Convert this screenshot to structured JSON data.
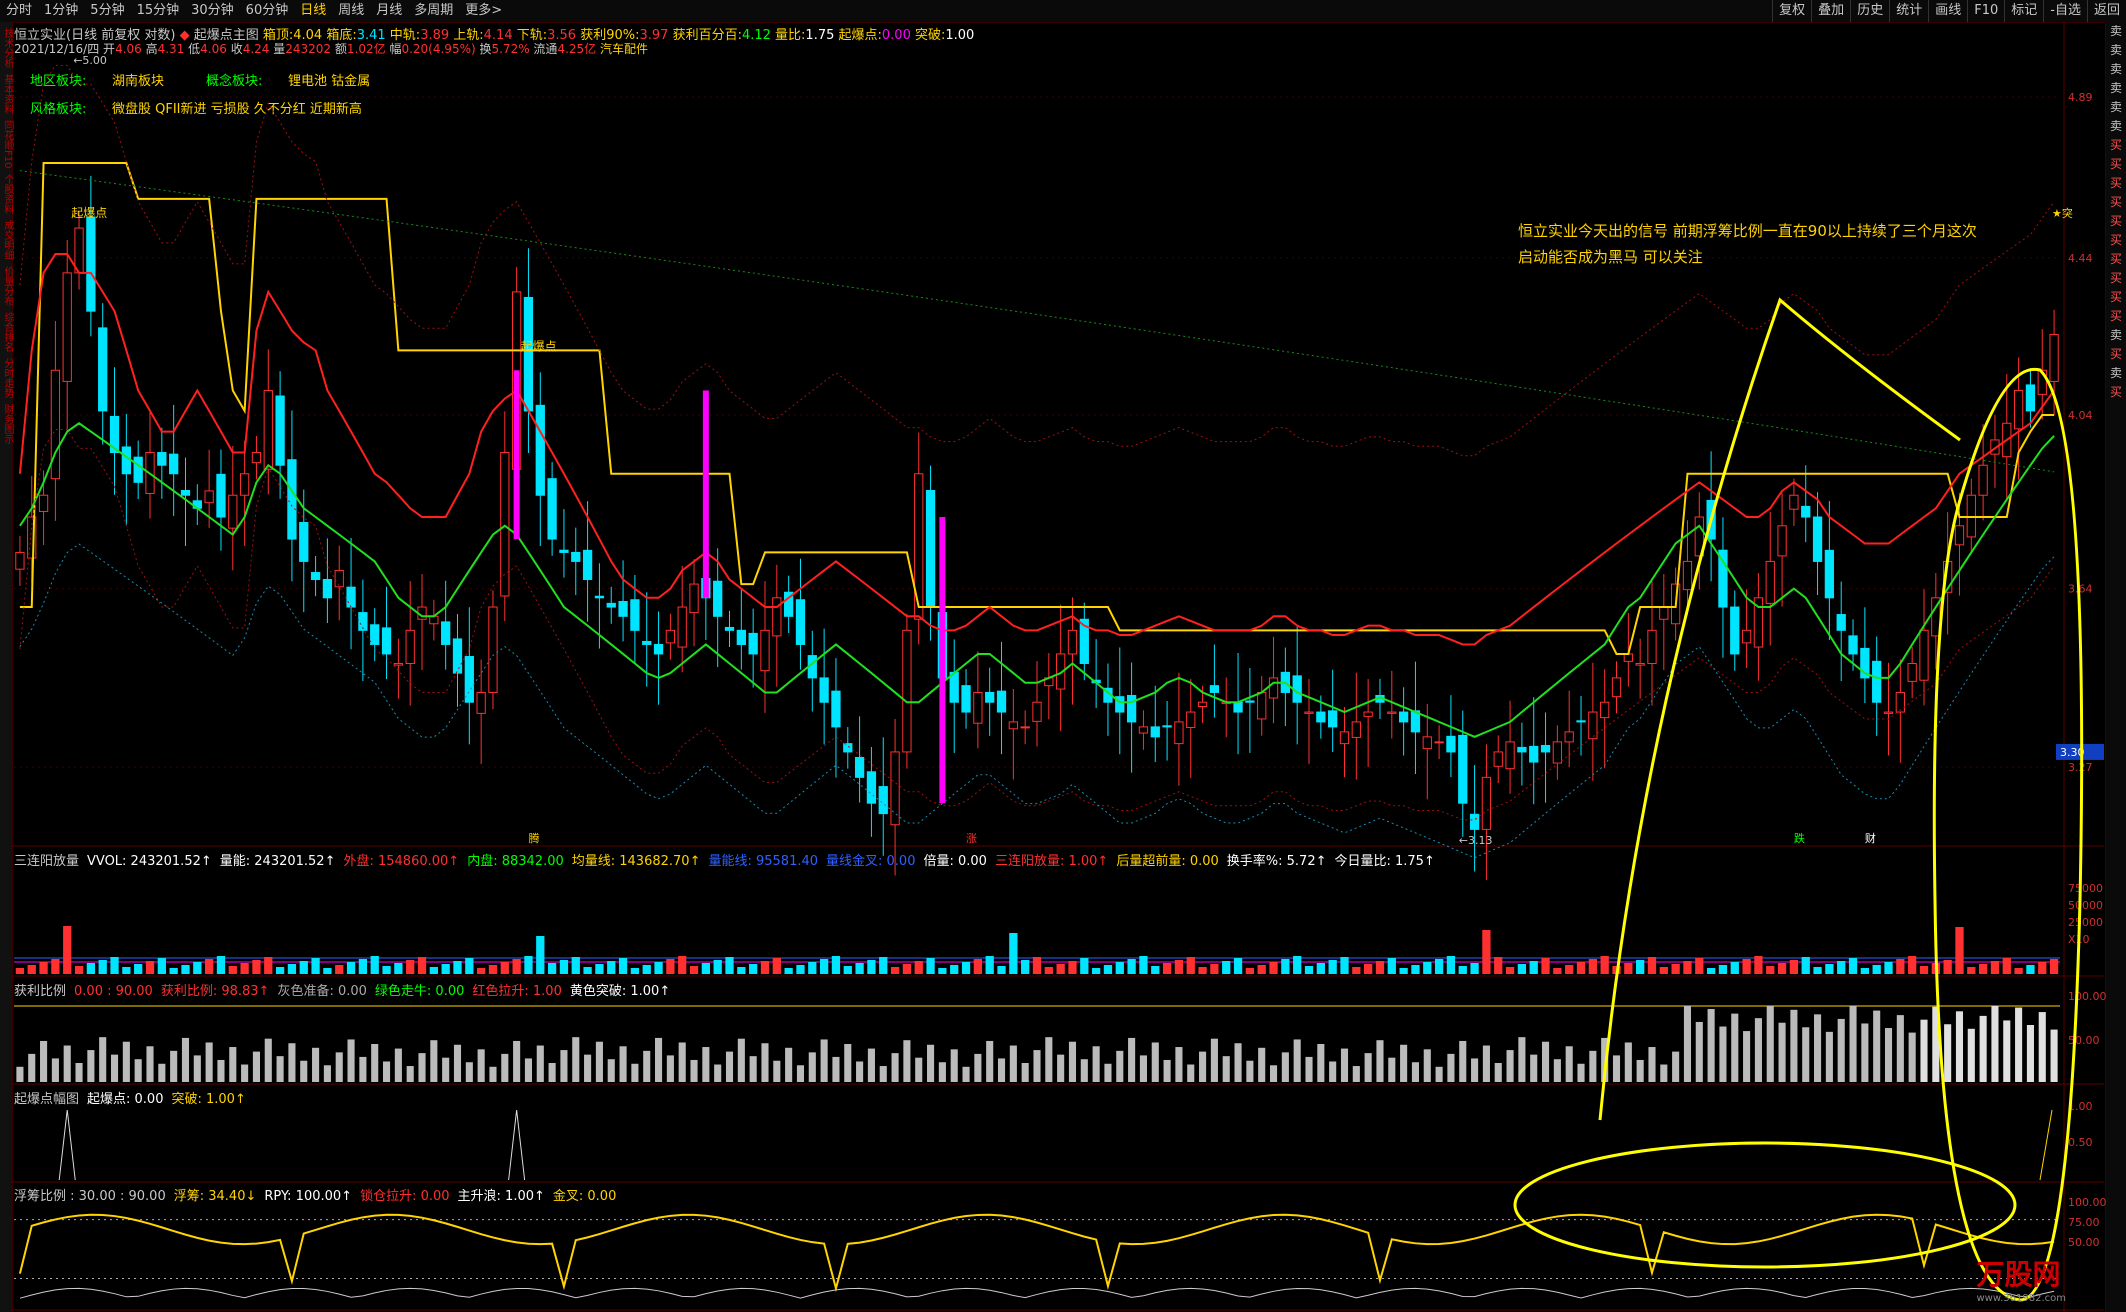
{
  "toolbar": {
    "periods": [
      "分时",
      "1分钟",
      "5分钟",
      "15分钟",
      "30分钟",
      "60分钟",
      "日线",
      "周线",
      "月线",
      "多周期",
      "更多>"
    ],
    "active": "日线",
    "right_buttons": [
      "复权",
      "叠加",
      "历史",
      "统计",
      "画线",
      "F10",
      "标记",
      "-自选",
      "返回"
    ]
  },
  "left_strip": [
    "技术分析",
    "基本资料",
    "同花顺F10",
    "个股资料",
    "成交明细",
    "价量分布",
    "综合排名",
    "分时走势",
    "财务图示"
  ],
  "right_strip": [
    "卖",
    "卖",
    "卖",
    "卖",
    "卖",
    "卖",
    "买",
    "买",
    "买",
    "买",
    "买",
    "买",
    "买",
    "买",
    "买",
    "买",
    "卖",
    "买",
    "卖",
    "买"
  ],
  "header": {
    "title": "恒立实业(日线 前复权 对数)",
    "indicator": "起爆点主图",
    "items": [
      {
        "label": "箱顶:",
        "value": "4.04",
        "color": "#ffd400"
      },
      {
        "label": "箱底:",
        "value": "3.41",
        "color": "#00e5ff"
      },
      {
        "label": "中轨:",
        "value": "3.89",
        "color": "#ff3030"
      },
      {
        "label": "上轨:",
        "value": "4.14",
        "color": "#ff3030"
      },
      {
        "label": "下轨:",
        "value": "3.56",
        "color": "#ff3030"
      },
      {
        "label": "获利90%:",
        "value": "3.97",
        "color": "#ff3030"
      },
      {
        "label": "获利百分百:",
        "value": "4.12",
        "color": "#00ff00"
      },
      {
        "label": "量比:",
        "value": "1.75",
        "color": "#ffffff"
      },
      {
        "label": "起爆点:",
        "value": "0.00",
        "color": "#ff00ff"
      },
      {
        "label": "突破:",
        "value": "1.00",
        "color": "#ffffff"
      }
    ],
    "date_line": "2021/12/16/四",
    "ohlc": [
      {
        "label": "开",
        "value": "4.06"
      },
      {
        "label": "高",
        "value": "4.31"
      },
      {
        "label": "低",
        "value": "4.06"
      },
      {
        "label": "收",
        "value": "4.24"
      },
      {
        "label": "量",
        "value": "243202"
      },
      {
        "label": "额",
        "value": "1.02亿"
      },
      {
        "label": "幅",
        "value": "0.20(4.95%)"
      },
      {
        "label": "换",
        "value": "5.72%"
      },
      {
        "label": "流通",
        "value": "4.25亿"
      }
    ],
    "sector_tail": "汽车配件"
  },
  "tags": {
    "region_label": "地区板块:",
    "region_value": "湖南板块",
    "concept_label": "概念板块:",
    "concept_value": "锂电池 钴金属",
    "style_label": "风格板块:",
    "style_value": "微盘股 QFII新进 亏损股 久不分红 近期新高"
  },
  "annotation": [
    "恒立实业今天出的信号 前期浮筹比例一直在90以上持续了三个月这次",
    "启动能否成为黑马 可以关注"
  ],
  "markers": {
    "qibao": "起爆点",
    "hi_label": "5.00",
    "lo_label": "3.13",
    "tu": "突",
    "teng": "腾",
    "zhang": "涨",
    "die": "跌",
    "cai": "财"
  },
  "price_axis": [
    "4.89",
    "4.44",
    "4.04",
    "3.64",
    "3.27"
  ],
  "last_price": "3.30",
  "panels": {
    "vol": {
      "head": [
        {
          "t": "三连阳放量",
          "c": "#c8c8c8"
        },
        {
          "t": "VVOL: 243201.52↑",
          "c": "#ffffff"
        },
        {
          "t": "量能: 243201.52↑",
          "c": "#ffffff"
        },
        {
          "t": "外盘: 154860.00↑",
          "c": "#ff3030"
        },
        {
          "t": "内盘: 88342.00",
          "c": "#00ff00"
        },
        {
          "t": "均量线: 143682.70↑",
          "c": "#ffd400"
        },
        {
          "t": "量能线: 95581.40",
          "c": "#3060ff"
        },
        {
          "t": "量线金叉: 0.00",
          "c": "#3060ff"
        },
        {
          "t": "倍量: 0.00",
          "c": "#ffffff"
        },
        {
          "t": "三连阳放量: 1.00↑",
          "c": "#ff3030"
        },
        {
          "t": "后量超前量: 0.00",
          "c": "#ffd400"
        },
        {
          "t": "换手率%: 5.72↑",
          "c": "#ffffff"
        },
        {
          "t": "今日量比: 1.75↑",
          "c": "#ffffff"
        }
      ],
      "axis": [
        "75000",
        "50000",
        "25000",
        "X10"
      ]
    },
    "profit": {
      "head": [
        {
          "t": "获利比例",
          "c": "#c8c8c8"
        },
        {
          "t": "0.00 : 90.00",
          "c": "#ff3030"
        },
        {
          "t": "获利比例: 98.83↑",
          "c": "#ff3030"
        },
        {
          "t": "灰色准备: 0.00",
          "c": "#aaaaaa"
        },
        {
          "t": "绿色走牛: 0.00",
          "c": "#00ff00"
        },
        {
          "t": "红色拉升: 1.00",
          "c": "#ff3030"
        },
        {
          "t": "黄色突破: 1.00↑",
          "c": "#ffffff"
        }
      ],
      "axis": [
        "100.00",
        "50.00"
      ]
    },
    "qbd": {
      "head": [
        {
          "t": "起爆点幅图",
          "c": "#c8c8c8"
        },
        {
          "t": "起爆点: 0.00",
          "c": "#ffffff"
        },
        {
          "t": "突破: 1.00↑",
          "c": "#ffd400"
        }
      ],
      "axis": [
        "1.00",
        "0.50"
      ]
    },
    "float": {
      "head": [
        {
          "t": "浮筹比例 : 30.00 : 90.00",
          "c": "#c8c8c8"
        },
        {
          "t": "浮筹: 34.40↓",
          "c": "#ffd400"
        },
        {
          "t": "RPY: 100.00↑",
          "c": "#ffffff"
        },
        {
          "t": "锁仓拉升: 0.00",
          "c": "#ff3030"
        },
        {
          "t": "主升浪: 1.00↑",
          "c": "#ffffff"
        },
        {
          "t": "金叉: 0.00",
          "c": "#ffd400"
        }
      ],
      "axis": [
        "100.00",
        "75.00",
        "50.00"
      ]
    }
  },
  "watermark": {
    "brand": "万股网",
    "url": "www.361982.com"
  },
  "chart_data": {
    "type": "candlestick",
    "title": "恒立实业(日线 前复权 对数)",
    "scale": "log",
    "ylim": [
      3.13,
      5.0
    ],
    "note_values": {
      "high": 5.0,
      "low": 3.13,
      "last_close": 4.24
    },
    "series": [
      {
        "name": "箱顶",
        "color": "#ffd400"
      },
      {
        "name": "中轨",
        "color": "#ff3030"
      },
      {
        "name": "获利百分百",
        "color": "#00ff00"
      }
    ],
    "close": [
      3.72,
      3.8,
      3.85,
      4.15,
      4.4,
      4.52,
      4.3,
      4.05,
      3.95,
      3.9,
      3.88,
      3.95,
      3.92,
      3.9,
      3.85,
      3.82,
      3.86,
      3.8,
      3.85,
      3.9,
      3.95,
      4.1,
      3.92,
      3.75,
      3.7,
      3.66,
      3.62,
      3.68,
      3.6,
      3.55,
      3.52,
      3.5,
      3.48,
      3.55,
      3.6,
      3.58,
      3.52,
      3.46,
      3.4,
      3.42,
      3.6,
      3.95,
      4.35,
      4.05,
      3.85,
      3.75,
      3.72,
      3.7,
      3.66,
      3.62,
      3.6,
      3.58,
      3.55,
      3.52,
      3.5,
      3.55,
      3.6,
      3.65,
      3.62,
      3.58,
      3.55,
      3.52,
      3.5,
      3.55,
      3.62,
      3.58,
      3.52,
      3.45,
      3.4,
      3.35,
      3.3,
      3.25,
      3.2,
      3.18,
      3.3,
      3.55,
      3.9,
      3.6,
      3.45,
      3.4,
      3.38,
      3.42,
      3.4,
      3.38,
      3.36,
      3.35,
      3.4,
      3.45,
      3.5,
      3.55,
      3.48,
      3.44,
      3.4,
      3.38,
      3.36,
      3.35,
      3.33,
      3.35,
      3.36,
      3.38,
      3.4,
      3.42,
      3.4,
      3.38,
      3.4,
      3.42,
      3.45,
      3.42,
      3.4,
      3.38,
      3.36,
      3.35,
      3.34,
      3.36,
      3.38,
      3.4,
      3.38,
      3.36,
      3.34,
      3.33,
      3.32,
      3.3,
      3.2,
      3.15,
      3.25,
      3.3,
      3.32,
      3.3,
      3.28,
      3.3,
      3.32,
      3.34,
      3.36,
      3.38,
      3.4,
      3.45,
      3.5,
      3.48,
      3.55,
      3.6,
      3.65,
      3.7,
      3.8,
      3.75,
      3.6,
      3.5,
      3.55,
      3.62,
      3.7,
      3.78,
      3.85,
      3.8,
      3.7,
      3.62,
      3.55,
      3.5,
      3.45,
      3.4,
      3.38,
      3.42,
      3.48,
      3.55,
      3.62,
      3.7,
      3.78,
      3.85,
      3.92,
      3.98,
      4.02,
      4.1,
      4.05,
      4.15,
      4.24
    ],
    "box_top": [
      3.6,
      3.6,
      4.7,
      4.7,
      4.7,
      4.7,
      4.7,
      4.7,
      4.7,
      4.7,
      4.6,
      4.6,
      4.6,
      4.6,
      4.6,
      4.6,
      4.6,
      4.3,
      4.1,
      4.05,
      4.6,
      4.6,
      4.6,
      4.6,
      4.6,
      4.6,
      4.6,
      4.6,
      4.6,
      4.6,
      4.6,
      4.6,
      4.2,
      4.2,
      4.2,
      4.2,
      4.2,
      4.2,
      4.2,
      4.2,
      4.2,
      4.2,
      4.2,
      4.2,
      4.2,
      4.2,
      4.2,
      4.2,
      4.2,
      4.2,
      3.9,
      3.9,
      3.9,
      3.9,
      3.9,
      3.9,
      3.9,
      3.9,
      3.9,
      3.9,
      3.9,
      3.65,
      3.65,
      3.72,
      3.72,
      3.72,
      3.72,
      3.72,
      3.72,
      3.72,
      3.72,
      3.72,
      3.72,
      3.72,
      3.72,
      3.72,
      3.6,
      3.6,
      3.6,
      3.6,
      3.6,
      3.6,
      3.6,
      3.6,
      3.6,
      3.6,
      3.6,
      3.6,
      3.6,
      3.6,
      3.6,
      3.6,
      3.6,
      3.55,
      3.55,
      3.55,
      3.55,
      3.55,
      3.55,
      3.55,
      3.55,
      3.55,
      3.55,
      3.55,
      3.55,
      3.55,
      3.55,
      3.55,
      3.55,
      3.55,
      3.55,
      3.55,
      3.55,
      3.55,
      3.55,
      3.55,
      3.55,
      3.55,
      3.55,
      3.55,
      3.55,
      3.55,
      3.55,
      3.55,
      3.55,
      3.55,
      3.55,
      3.55,
      3.55,
      3.55,
      3.55,
      3.55,
      3.55,
      3.55,
      3.55,
      3.5,
      3.5,
      3.6,
      3.6,
      3.6,
      3.6,
      3.9,
      3.9,
      3.9,
      3.9,
      3.9,
      3.9,
      3.9,
      3.9,
      3.9,
      3.9,
      3.9,
      3.9,
      3.9,
      3.9,
      3.9,
      3.9,
      3.9,
      3.9,
      3.9,
      3.9,
      3.9,
      3.9,
      3.9,
      3.8,
      3.8,
      3.8,
      3.8,
      3.8,
      3.95,
      4.0,
      4.04,
      4.04
    ],
    "mid": [
      3.9,
      4.2,
      4.4,
      4.45,
      4.45,
      4.4,
      4.4,
      4.35,
      4.3,
      4.2,
      4.1,
      4.05,
      4.0,
      4.0,
      4.05,
      4.1,
      4.05,
      4.0,
      3.95,
      3.95,
      4.25,
      4.35,
      4.3,
      4.25,
      4.22,
      4.2,
      4.1,
      4.05,
      4.0,
      3.95,
      3.9,
      3.88,
      3.85,
      3.82,
      3.8,
      3.8,
      3.8,
      3.85,
      3.9,
      4.0,
      4.05,
      4.08,
      4.1,
      4.05,
      4.0,
      3.95,
      3.9,
      3.85,
      3.8,
      3.75,
      3.7,
      3.66,
      3.64,
      3.62,
      3.62,
      3.64,
      3.68,
      3.7,
      3.72,
      3.7,
      3.66,
      3.64,
      3.62,
      3.6,
      3.6,
      3.62,
      3.64,
      3.66,
      3.68,
      3.7,
      3.68,
      3.66,
      3.64,
      3.62,
      3.6,
      3.58,
      3.58,
      3.56,
      3.55,
      3.55,
      3.56,
      3.58,
      3.6,
      3.58,
      3.56,
      3.55,
      3.55,
      3.56,
      3.57,
      3.58,
      3.56,
      3.55,
      3.55,
      3.54,
      3.54,
      3.55,
      3.56,
      3.57,
      3.58,
      3.57,
      3.56,
      3.55,
      3.55,
      3.55,
      3.55,
      3.56,
      3.58,
      3.58,
      3.56,
      3.55,
      3.55,
      3.54,
      3.54,
      3.55,
      3.56,
      3.56,
      3.55,
      3.55,
      3.54,
      3.54,
      3.54,
      3.53,
      3.52,
      3.52,
      3.54,
      3.55,
      3.56,
      3.58,
      3.6,
      3.62,
      3.64,
      3.66,
      3.68,
      3.7,
      3.72,
      3.74,
      3.76,
      3.78,
      3.8,
      3.82,
      3.84,
      3.86,
      3.88,
      3.86,
      3.84,
      3.82,
      3.8,
      3.8,
      3.82,
      3.86,
      3.88,
      3.86,
      3.84,
      3.8,
      3.78,
      3.76,
      3.74,
      3.74,
      3.74,
      3.76,
      3.78,
      3.8,
      3.82,
      3.86,
      3.9,
      3.92,
      3.94,
      3.96,
      3.98,
      4.0,
      4.02,
      4.06,
      4.1
    ],
    "profit_full": [
      3.78,
      3.82,
      3.88,
      3.95,
      4.0,
      4.02,
      4.0,
      3.98,
      3.96,
      3.94,
      3.92,
      3.9,
      3.88,
      3.86,
      3.84,
      3.82,
      3.8,
      3.78,
      3.76,
      3.8,
      3.88,
      3.92,
      3.9,
      3.86,
      3.82,
      3.8,
      3.78,
      3.76,
      3.74,
      3.72,
      3.7,
      3.66,
      3.62,
      3.6,
      3.58,
      3.58,
      3.6,
      3.64,
      3.68,
      3.72,
      3.76,
      3.78,
      3.76,
      3.72,
      3.68,
      3.64,
      3.6,
      3.58,
      3.56,
      3.54,
      3.52,
      3.5,
      3.48,
      3.46,
      3.45,
      3.46,
      3.48,
      3.5,
      3.52,
      3.5,
      3.48,
      3.46,
      3.44,
      3.42,
      3.42,
      3.44,
      3.46,
      3.48,
      3.5,
      3.52,
      3.5,
      3.48,
      3.46,
      3.44,
      3.42,
      3.4,
      3.4,
      3.42,
      3.44,
      3.46,
      3.48,
      3.5,
      3.5,
      3.48,
      3.46,
      3.44,
      3.44,
      3.45,
      3.46,
      3.48,
      3.46,
      3.44,
      3.42,
      3.4,
      3.4,
      3.41,
      3.42,
      3.44,
      3.45,
      3.44,
      3.42,
      3.41,
      3.4,
      3.4,
      3.41,
      3.42,
      3.44,
      3.44,
      3.42,
      3.41,
      3.4,
      3.39,
      3.38,
      3.39,
      3.4,
      3.41,
      3.4,
      3.39,
      3.38,
      3.37,
      3.36,
      3.35,
      3.34,
      3.33,
      3.34,
      3.35,
      3.36,
      3.38,
      3.4,
      3.42,
      3.44,
      3.46,
      3.48,
      3.5,
      3.52,
      3.56,
      3.6,
      3.62,
      3.66,
      3.7,
      3.74,
      3.76,
      3.78,
      3.74,
      3.7,
      3.66,
      3.62,
      3.6,
      3.6,
      3.62,
      3.64,
      3.62,
      3.58,
      3.54,
      3.5,
      3.48,
      3.46,
      3.45,
      3.45,
      3.48,
      3.52,
      3.56,
      3.6,
      3.64,
      3.68,
      3.72,
      3.76,
      3.8,
      3.84,
      3.88,
      3.92,
      3.96,
      3.99
    ]
  }
}
